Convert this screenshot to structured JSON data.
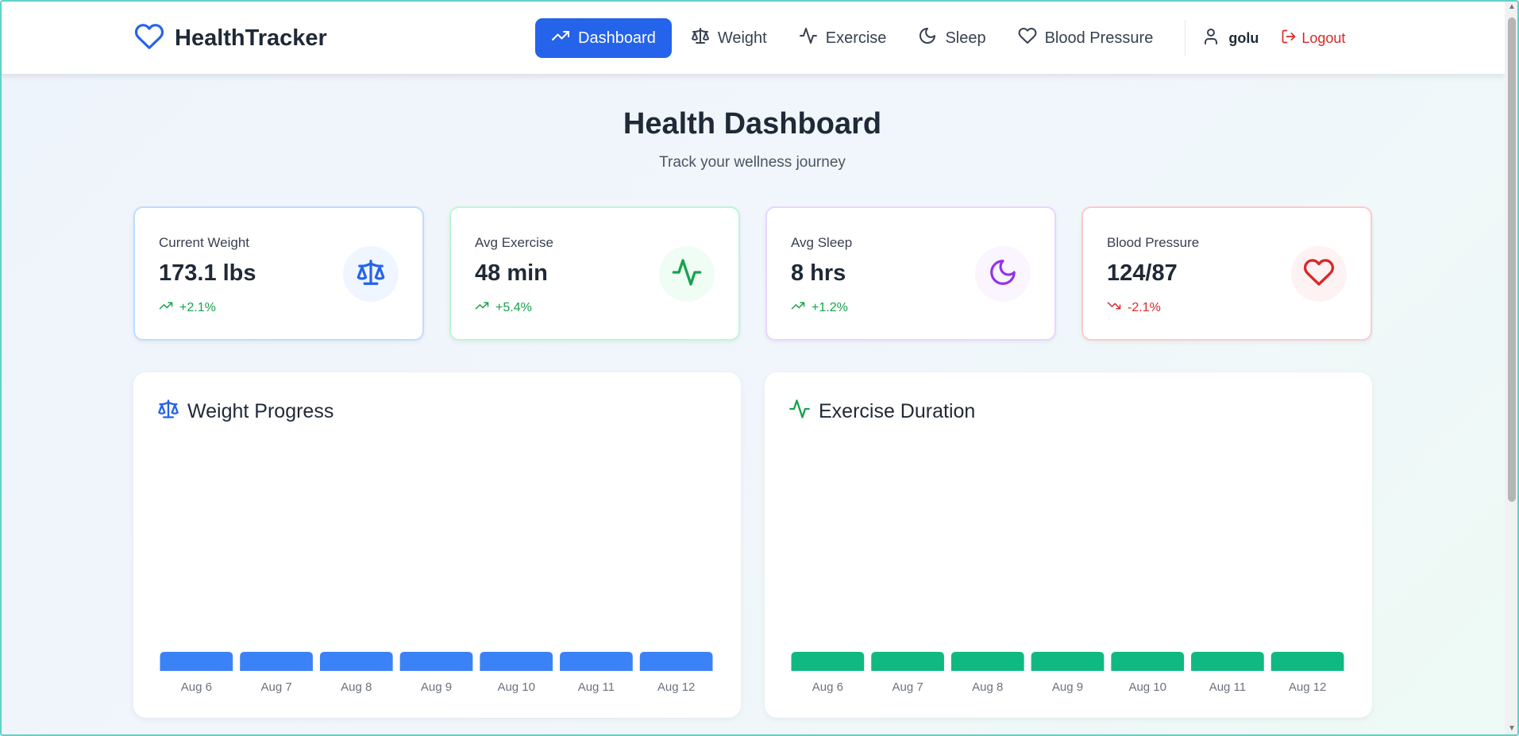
{
  "app": {
    "brand": "HealthTracker",
    "accent": "#2563eb"
  },
  "nav": {
    "items": [
      {
        "label": "Dashboard",
        "icon": "trending-up-icon",
        "active": true
      },
      {
        "label": "Weight",
        "icon": "scale-icon",
        "active": false
      },
      {
        "label": "Exercise",
        "icon": "activity-icon",
        "active": false
      },
      {
        "label": "Sleep",
        "icon": "moon-icon",
        "active": false
      },
      {
        "label": "Blood Pressure",
        "icon": "heart-icon",
        "active": false
      }
    ],
    "user": "golu",
    "logout": "Logout"
  },
  "header": {
    "title": "Health Dashboard",
    "subtitle": "Track your wellness journey"
  },
  "stats": [
    {
      "label": "Current Weight",
      "value": "173.1 lbs",
      "change": "+2.1%",
      "trend": "up",
      "icon": "scale-icon",
      "color": "#2563eb",
      "border": "#bfdbfe",
      "bg": "#eff6ff"
    },
    {
      "label": "Avg Exercise",
      "value": "48 min",
      "change": "+5.4%",
      "trend": "up",
      "icon": "activity-icon",
      "color": "#16a34a",
      "border": "#bbf7d0",
      "bg": "#f0fdf4"
    },
    {
      "label": "Avg Sleep",
      "value": "8 hrs",
      "change": "+1.2%",
      "trend": "up",
      "icon": "moon-icon",
      "color": "#9333ea",
      "border": "#e9d5ff",
      "bg": "#faf5ff"
    },
    {
      "label": "Blood Pressure",
      "value": "124/87",
      "change": "-2.1%",
      "trend": "down",
      "icon": "heart-icon",
      "color": "#dc2626",
      "border": "#fecaca",
      "bg": "#fef2f2"
    }
  ],
  "charts": {
    "weight": {
      "title": "Weight Progress",
      "color": "#3b82f6"
    },
    "exercise": {
      "title": "Exercise Duration",
      "color": "#10b981"
    }
  },
  "chart_data": [
    {
      "type": "bar",
      "title": "Weight Progress",
      "categories": [
        "Aug 6",
        "Aug 7",
        "Aug 8",
        "Aug 9",
        "Aug 10",
        "Aug 11",
        "Aug 12"
      ],
      "xlabel": "",
      "ylabel": "",
      "color": "#3b82f6"
    },
    {
      "type": "bar",
      "title": "Exercise Duration",
      "categories": [
        "Aug 6",
        "Aug 7",
        "Aug 8",
        "Aug 9",
        "Aug 10",
        "Aug 11",
        "Aug 12"
      ],
      "xlabel": "",
      "ylabel": "",
      "color": "#10b981"
    }
  ]
}
